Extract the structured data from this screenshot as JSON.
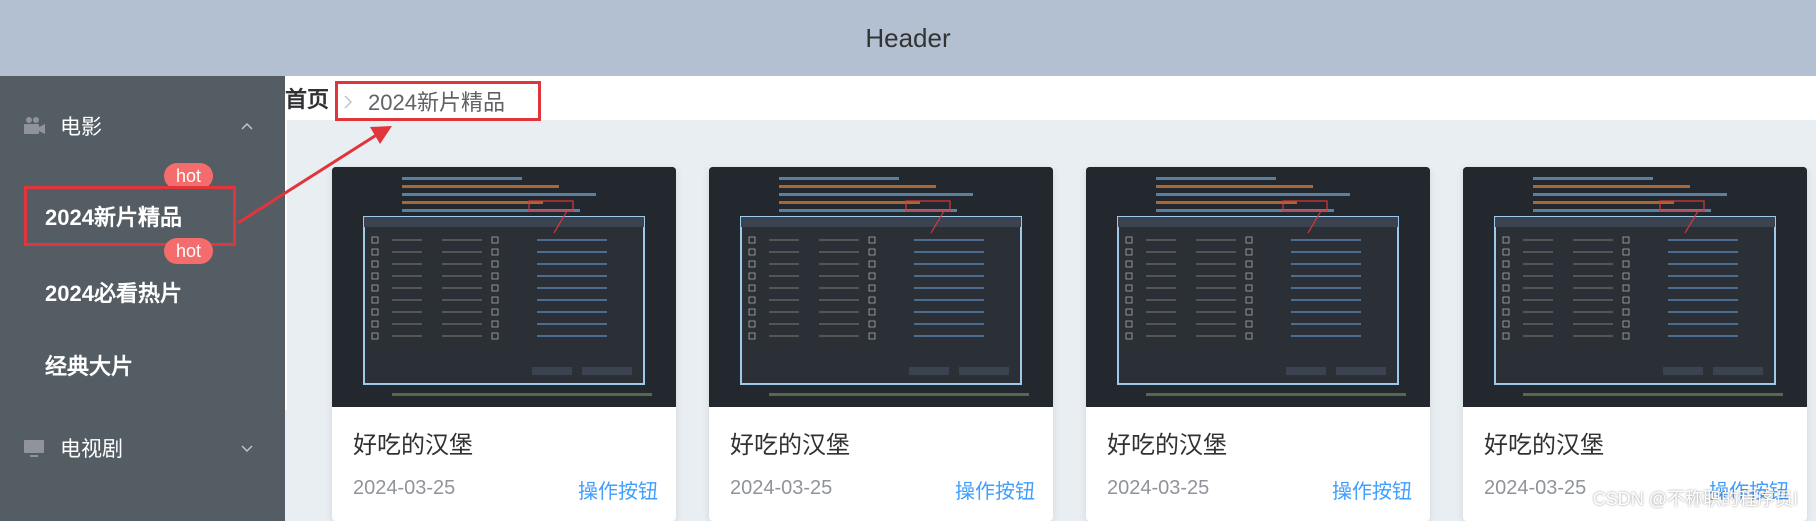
{
  "header": {
    "title": "Header"
  },
  "sidebar": {
    "groups": [
      {
        "label": "电影",
        "icon": "camera-icon",
        "expanded": true
      },
      {
        "label": "电视剧",
        "icon": "monitor-icon",
        "expanded": false
      }
    ],
    "items": [
      {
        "label": "2024新片精品",
        "badge": "hot",
        "active": true
      },
      {
        "label": "2024必看热片",
        "badge": "hot",
        "active": false
      },
      {
        "label": "经典大片",
        "badge": "",
        "active": false
      }
    ]
  },
  "breadcrumb": {
    "home": "首页",
    "current": "2024新片精品"
  },
  "cards": [
    {
      "title": "好吃的汉堡",
      "date": "2024-03-25",
      "button": "操作按钮"
    },
    {
      "title": "好吃的汉堡",
      "date": "2024-03-25",
      "button": "操作按钮"
    },
    {
      "title": "好吃的汉堡",
      "date": "2024-03-25",
      "button": "操作按钮"
    },
    {
      "title": "好吃的汉堡",
      "date": "2024-03-25",
      "button": "操作按钮"
    }
  ],
  "watermark": "CSDN @不称职的程序员I",
  "colors": {
    "header_bg": "#b3c0d1",
    "sidebar_bg": "#545c64",
    "accent": "#409eff",
    "badge": "#f56c6c",
    "annotation": "#e0353b"
  }
}
